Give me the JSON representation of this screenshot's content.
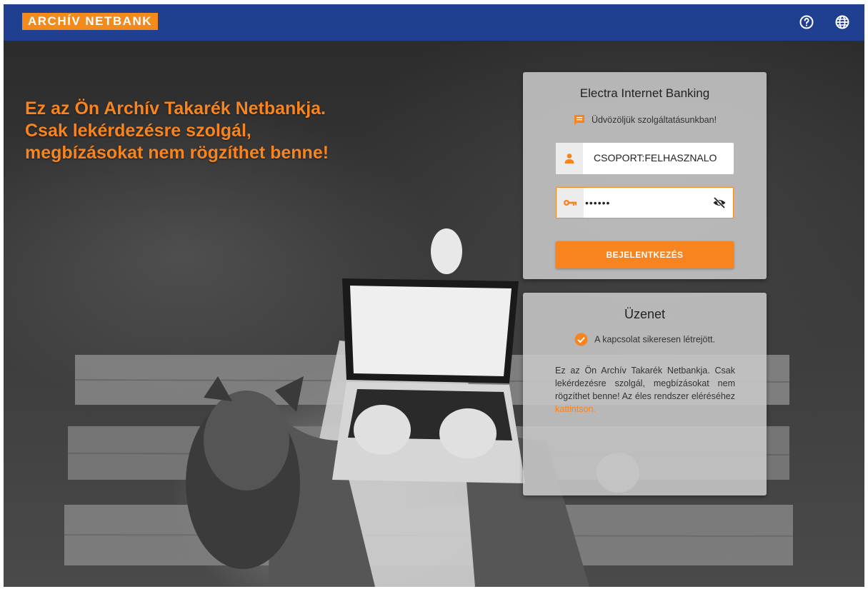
{
  "header": {
    "logo_text": "ARCHÍV NETBANK",
    "help_icon": "help-circle-icon",
    "language_icon": "globe-icon"
  },
  "hero": {
    "headline_lines": [
      "Ez az Ön Archív Takarék Netbankja.",
      "Csak lekérdezésre szolgál,",
      "megbízásokat nem rögzíthet benne!"
    ]
  },
  "login": {
    "title": "Electra Internet Banking",
    "welcome": "Üdvözöljük szolgáltatásunkban!",
    "username_value": "CSOPORT:FELHASZNALO",
    "password_value": "••••••",
    "submit_label": "BEJELENTKEZÉS"
  },
  "message": {
    "title": "Üzenet",
    "status": "A kapcsolat sikeresen létrejött.",
    "body_text": "Ez az Ön Archív Takarék Netbankja. Csak lekérdezésre szolgál, megbízásokat nem rögzíthet benne! Az éles rendszer eléréséhez ",
    "link_text": "kattintson."
  },
  "colors": {
    "header_bg": "#1f3f91",
    "accent": "#f7841f",
    "card_bg": "#c8c8c8"
  }
}
